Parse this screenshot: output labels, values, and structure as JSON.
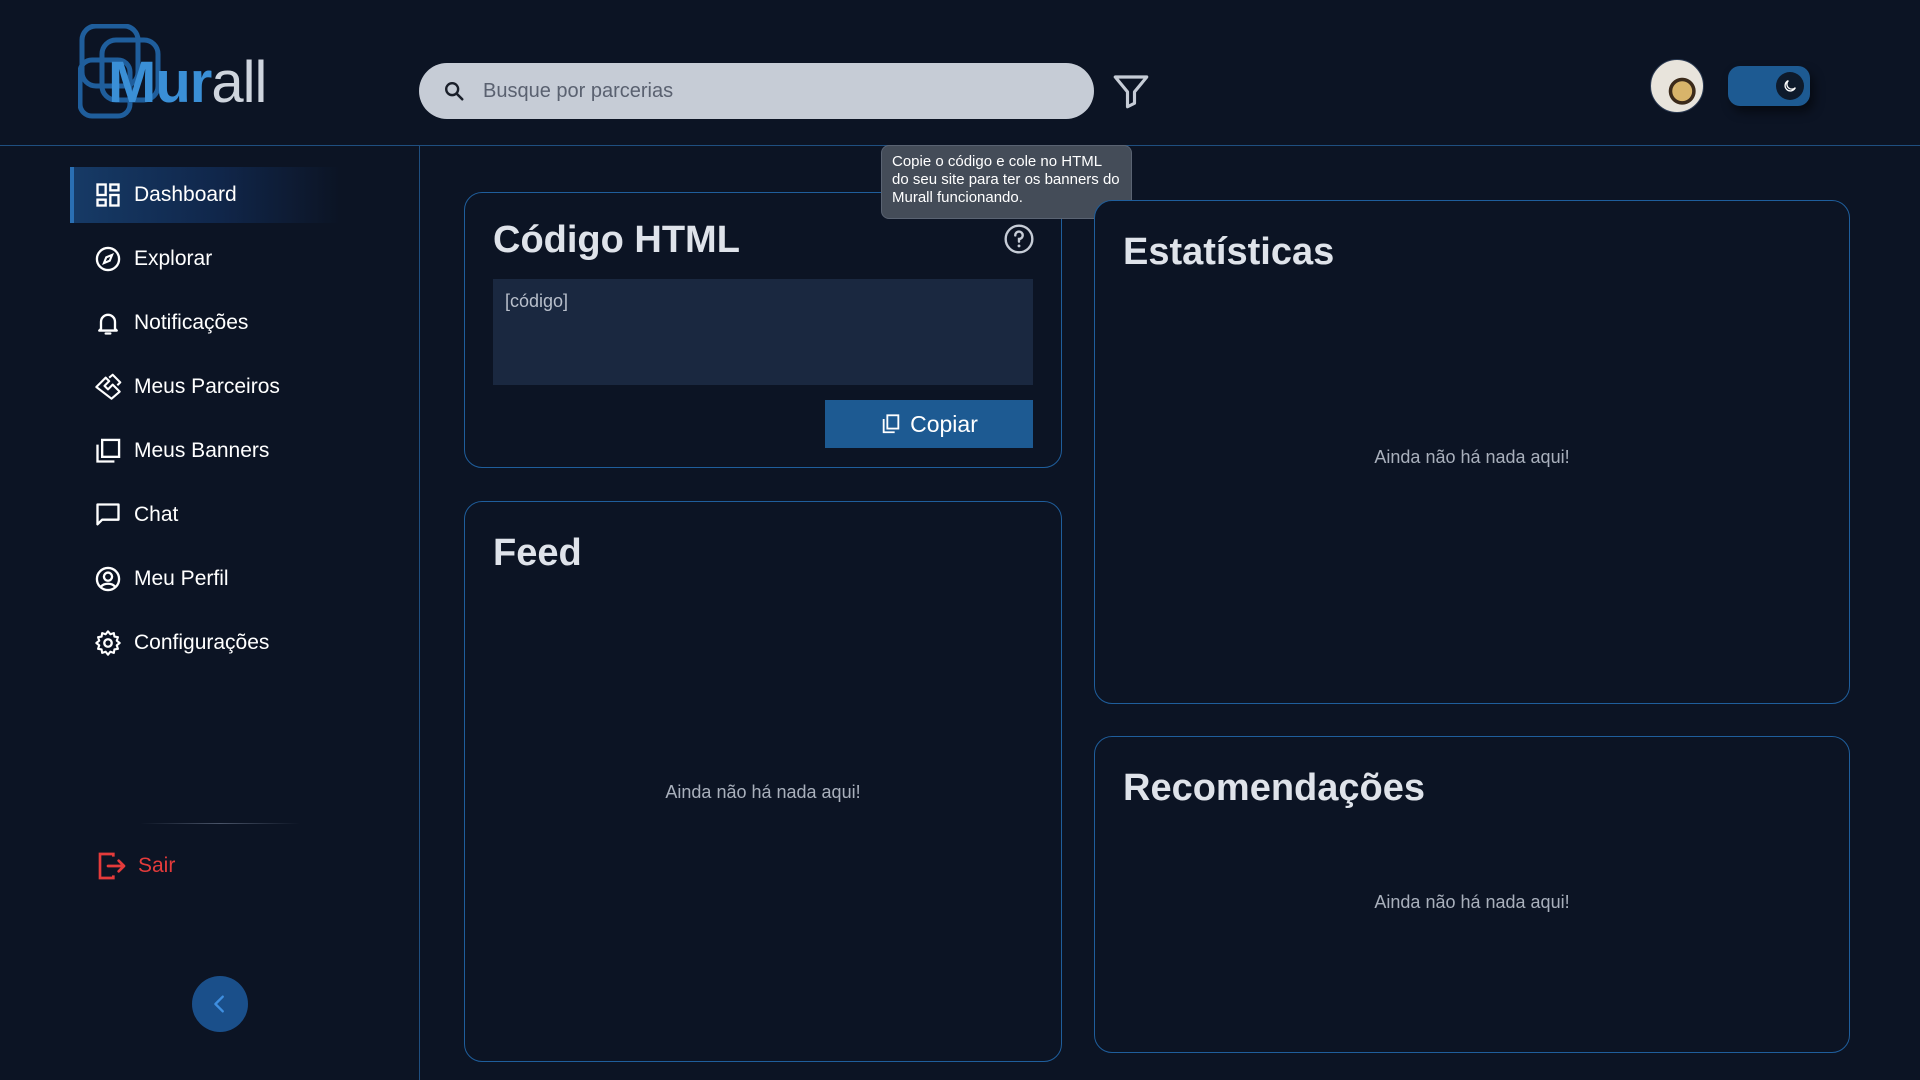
{
  "header": {
    "logo_main": "Mur",
    "logo_tail": "all",
    "search_placeholder": "Busque por parcerias"
  },
  "sidebar": {
    "items": [
      {
        "label": "Dashboard",
        "icon": "dashboard-icon",
        "active": true
      },
      {
        "label": "Explorar",
        "icon": "compass-icon"
      },
      {
        "label": "Notificações",
        "icon": "bell-icon"
      },
      {
        "label": "Meus Parceiros",
        "icon": "handshake-icon"
      },
      {
        "label": "Meus Banners",
        "icon": "banners-icon"
      },
      {
        "label": "Chat",
        "icon": "chat-icon"
      },
      {
        "label": "Meu Perfil",
        "icon": "profile-icon"
      },
      {
        "label": "Configurações",
        "icon": "settings-icon"
      }
    ],
    "logout_label": "Sair"
  },
  "code_card": {
    "title": "Código HTML",
    "code_value": "[código]",
    "copy_label": "Copiar",
    "tooltip": "Copie o código e cole no HTML do seu site para ter os banners do Murall funcionando."
  },
  "feed_card": {
    "title": "Feed",
    "empty": "Ainda não há nada aqui!"
  },
  "stats_card": {
    "title": "Estatísticas",
    "empty": "Ainda não há nada aqui!"
  },
  "reco_card": {
    "title": "Recomendações",
    "empty": "Ainda não há nada aqui!"
  },
  "colors": {
    "background": "#0c1424",
    "accent": "#1d5a92",
    "border": "#1f5e9c",
    "danger": "#e53b3b"
  }
}
